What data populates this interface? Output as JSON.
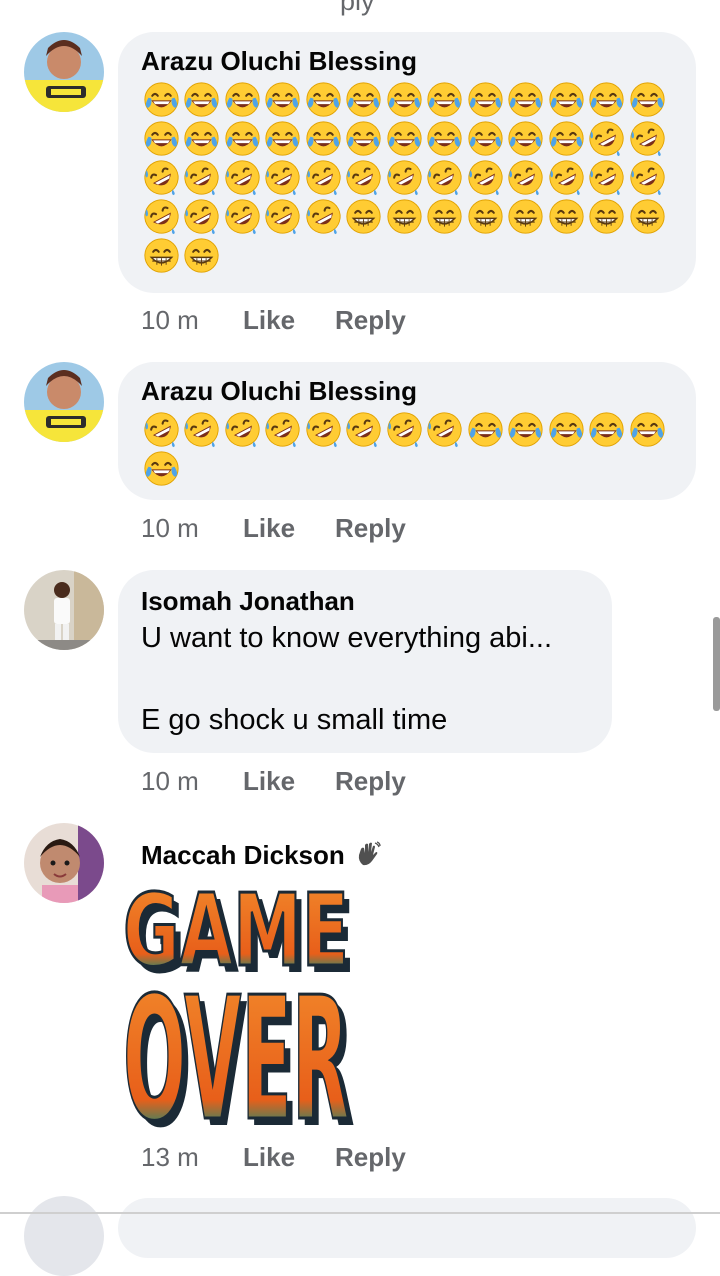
{
  "comments": [
    {
      "author": "Arazu Oluchi Blessing",
      "time": "10 m",
      "like_label": "Like",
      "reply_label": "Reply",
      "emoji_sequence": [
        "joy",
        "joy",
        "joy",
        "joy",
        "joy",
        "joy",
        "joy",
        "joy",
        "joy",
        "joy",
        "joy",
        "joy",
        "joy",
        "joy",
        "joy",
        "joy",
        "joy",
        "joy",
        "joy",
        "joy",
        "joy",
        "joy",
        "joy",
        "joy",
        "rofl",
        "rofl",
        "rofl",
        "rofl",
        "rofl",
        "rofl",
        "rofl",
        "rofl",
        "rofl",
        "rofl",
        "rofl",
        "rofl",
        "rofl",
        "rofl",
        "rofl",
        "rofl",
        "rofl",
        "rofl",
        "rofl",
        "rofl",
        "grin",
        "grin",
        "grin",
        "grin",
        "grin",
        "grin",
        "grin",
        "grin",
        "grin",
        "grin"
      ]
    },
    {
      "author": "Arazu Oluchi Blessing",
      "time": "10 m",
      "like_label": "Like",
      "reply_label": "Reply",
      "emoji_sequence": [
        "rofl",
        "rofl",
        "rofl",
        "rofl",
        "rofl",
        "rofl",
        "rofl",
        "rofl",
        "joy",
        "joy",
        "joy",
        "joy",
        "joy",
        "joy"
      ]
    },
    {
      "author": "Isomah Jonathan",
      "text_line1": "U want to know everything abi...",
      "text_line2": "E go shock u small time",
      "time": "10 m",
      "like_label": "Like",
      "reply_label": "Reply"
    },
    {
      "author": "Maccah Dickson",
      "badge_icon": "waving-hand-icon",
      "sticker": {
        "line1": "GAME",
        "line2": "OVER"
      },
      "time": "13 m",
      "like_label": "Like",
      "reply_label": "Reply"
    }
  ],
  "colors": {
    "bubble": "#f0f2f5",
    "meta_text": "#65676b",
    "emoji_face": "#ffcc33",
    "tear": "#4fa3e8",
    "sticker_orange": "#ee6a1f",
    "sticker_green": "#1f8a6e",
    "sticker_outline": "#1b2a36"
  }
}
